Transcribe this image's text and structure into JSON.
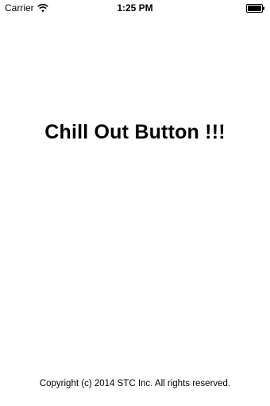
{
  "status_bar": {
    "carrier": "Carrier",
    "time": "1:25 PM",
    "battery_level": 1.0
  },
  "main": {
    "title": "Chill Out Button !!!"
  },
  "footer": {
    "copyright": "Copyright (c) 2014 STC Inc. All rights reserved."
  }
}
